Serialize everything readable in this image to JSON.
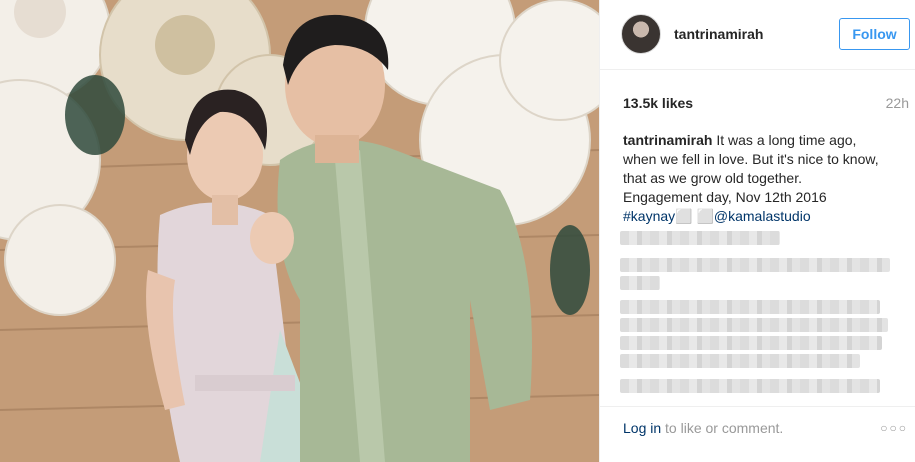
{
  "post": {
    "author": "tantrinamirah",
    "follow_label": "Follow",
    "likes": "13.5k likes",
    "time_ago": "22h",
    "caption_user": "tantrinamirah",
    "caption_lines": [
      "It was a long time ago,",
      "when we fell in love. But it's nice to know,",
      "that as we grow old together.",
      "Engagement day, Nov 12th 2016"
    ],
    "hashtag": "#kaynay⬜",
    "mention": "⬜@kamalastudio",
    "login_link": "Log in",
    "login_text": " to like or comment.",
    "more_glyph": "○○○"
  },
  "colors": {
    "link_blue": "#003569",
    "follow_blue": "#3897f0",
    "muted": "#999999"
  }
}
